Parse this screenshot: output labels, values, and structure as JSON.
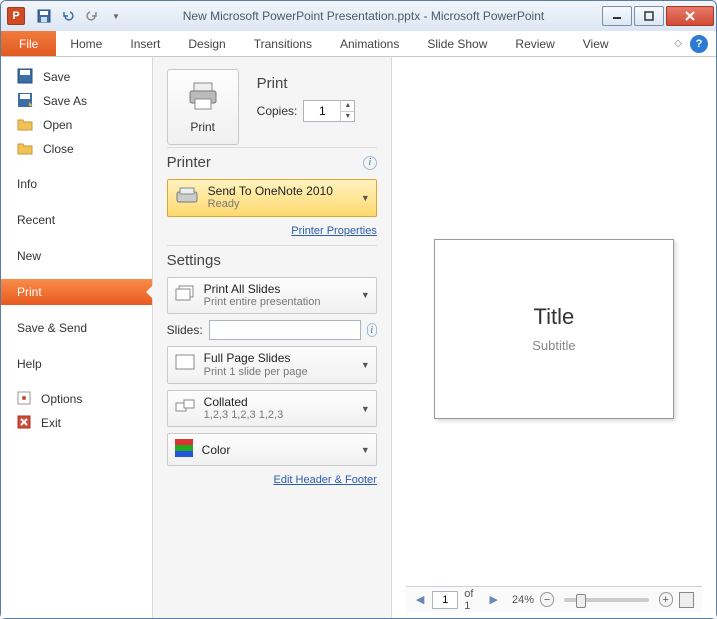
{
  "titlebar": {
    "title": "New Microsoft PowerPoint Presentation.pptx  -  Microsoft PowerPoint",
    "app_letter": "P"
  },
  "ribbon": {
    "file": "File",
    "tabs": [
      "Home",
      "Insert",
      "Design",
      "Transitions",
      "Animations",
      "Slide Show",
      "Review",
      "View"
    ]
  },
  "sidebar": {
    "icon_items": [
      {
        "label": "Save"
      },
      {
        "label": "Save As"
      },
      {
        "label": "Open"
      },
      {
        "label": "Close"
      }
    ],
    "text_items": [
      "Info",
      "Recent",
      "New",
      "Print",
      "Save & Send",
      "Help"
    ],
    "active": "Print",
    "footer_items": [
      {
        "label": "Options"
      },
      {
        "label": "Exit"
      }
    ]
  },
  "print": {
    "section": "Print",
    "button": "Print",
    "copies_label": "Copies:",
    "copies_value": "1"
  },
  "printer": {
    "section": "Printer",
    "name": "Send To OneNote 2010",
    "status": "Ready",
    "properties_link": "Printer Properties"
  },
  "settings": {
    "section": "Settings",
    "slides_option": {
      "main": "Print All Slides",
      "sub": "Print entire presentation"
    },
    "slides_label": "Slides:",
    "slides_value": "",
    "layout_option": {
      "main": "Full Page Slides",
      "sub": "Print 1 slide per page"
    },
    "collate_option": {
      "main": "Collated",
      "sub": "1,2,3   1,2,3   1,2,3"
    },
    "color_option": {
      "main": "Color"
    },
    "edit_link": "Edit Header & Footer"
  },
  "preview": {
    "title": "Title",
    "subtitle": "Subtitle"
  },
  "status": {
    "page": "1",
    "of_label": "of 1",
    "zoom": "24%"
  }
}
